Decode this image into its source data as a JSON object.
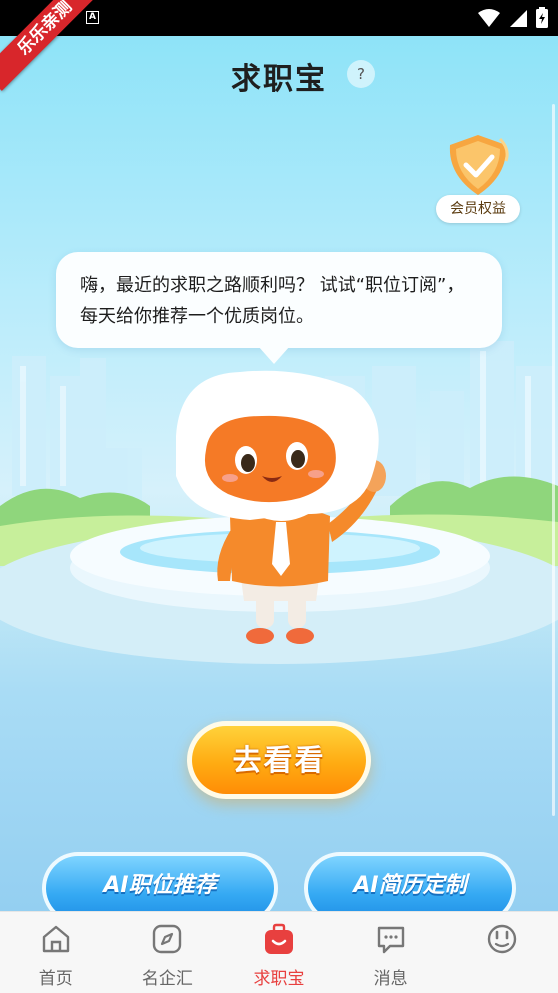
{
  "ribbon": {
    "text": "乐乐亲测"
  },
  "status": {
    "icons": [
      "android-a-icon",
      "wifi-icon",
      "signal-icon",
      "battery-icon"
    ]
  },
  "header": {
    "title": "求职宝",
    "help_symbol": "?"
  },
  "member_badge": {
    "label": "会员权益"
  },
  "bubble": {
    "text": "嗨，最近的求职之路顺利吗？ 试试“职位订阅”，每天给你推荐一个优质岗位。"
  },
  "cta": {
    "label": "去看看"
  },
  "features": [
    {
      "label": "AI职位推荐"
    },
    {
      "label": "AI简历定制"
    }
  ],
  "tabbar": {
    "items": [
      {
        "label": "首页",
        "icon": "home-icon",
        "active": false
      },
      {
        "label": "名企汇",
        "icon": "compass-icon",
        "active": false
      },
      {
        "label": "求职宝",
        "icon": "bag-icon",
        "active": true
      },
      {
        "label": "消息",
        "icon": "message-icon",
        "active": false
      },
      {
        "label": "",
        "icon": "profile-face-icon",
        "active": false
      }
    ]
  },
  "colors": {
    "accent": "#e8403f",
    "cta_orange": "#ff9d0c",
    "feature_blue": "#35a9f3"
  }
}
